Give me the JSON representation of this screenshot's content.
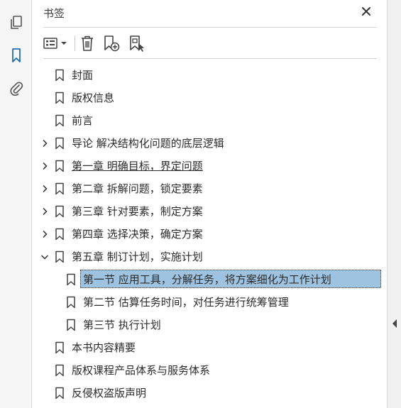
{
  "left_toolbar": {
    "icons": [
      "pages-icon",
      "bookmark-icon",
      "attachment-icon"
    ]
  },
  "panel": {
    "title": "书签",
    "close_icon": "close-icon",
    "toolbar": [
      "options-menu-icon",
      "delete-bookmark-icon",
      "new-bookmark-icon",
      "bookmark-from-structure-icon"
    ]
  },
  "bookmarks": [
    {
      "label": "封面",
      "level": 0,
      "expandable": false
    },
    {
      "label": "版权信息",
      "level": 0,
      "expandable": false
    },
    {
      "label": "前言",
      "level": 0,
      "expandable": false
    },
    {
      "label": "导论 解决结构化问题的底层逻辑",
      "level": 0,
      "expandable": true,
      "expanded": false
    },
    {
      "label": "第一章 明确目标，界定问题",
      "level": 0,
      "expandable": true,
      "expanded": false,
      "underlined": true
    },
    {
      "label": "第二章 拆解问题，锁定要素",
      "level": 0,
      "expandable": true,
      "expanded": false
    },
    {
      "label": "第三章 针对要素，制定方案",
      "level": 0,
      "expandable": true,
      "expanded": false
    },
    {
      "label": "第四章 选择决策，确定方案",
      "level": 0,
      "expandable": true,
      "expanded": false
    },
    {
      "label": "第五章 制订计划，实施计划",
      "level": 0,
      "expandable": true,
      "expanded": true
    },
    {
      "label": "第一节 应用工具，分解任务，将方案细化为工作计划",
      "level": 1,
      "expandable": false,
      "selected": true
    },
    {
      "label": "第二节 估算任务时间，对任务进行统筹管理",
      "level": 1,
      "expandable": false
    },
    {
      "label": "第三节 执行计划",
      "level": 1,
      "expandable": false
    },
    {
      "label": "本书内容精要",
      "level": 0,
      "expandable": false
    },
    {
      "label": "版权课程产品体系与服务体系",
      "level": 0,
      "expandable": false
    },
    {
      "label": "反侵权盗版声明",
      "level": 0,
      "expandable": false
    }
  ],
  "colors": {
    "selection": "#9ec3e0",
    "accent": "#1f6fb5"
  }
}
